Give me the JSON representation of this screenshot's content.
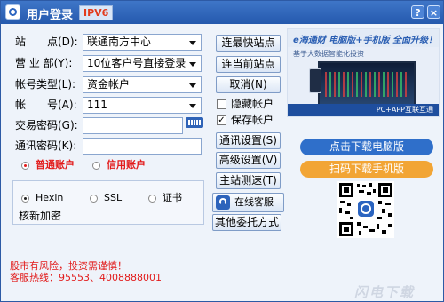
{
  "titlebar": {
    "title": "用户登录",
    "badge": "IPV6",
    "help_label": "?",
    "close_label": "×"
  },
  "form": {
    "labels": {
      "station": "站　　点(D):",
      "department": "营 业 部(Y):",
      "account_type": "帐号类型(L):",
      "account": "帐　　号(A):",
      "trade_password": "交易密码(G):",
      "comm_password": "通讯密码(K):"
    },
    "values": {
      "station": "联通南方中心",
      "department": "10位客户号直接登录",
      "account_type": "资金帐户",
      "account": "111",
      "trade_password": "",
      "comm_password": ""
    },
    "account_kind": {
      "normal": "普通账户",
      "credit": "信用账户",
      "selected": "normal"
    },
    "protocol": {
      "options": [
        "Hexin",
        "SSL",
        "证书"
      ],
      "selected": "Hexin",
      "encrypt_label": "核新加密"
    }
  },
  "buttons": {
    "fastest_station": "连最快站点",
    "current_station": "连当前站点",
    "cancel": "取消(N)",
    "comm_settings": "通讯设置(S)",
    "advanced_settings": "高级设置(V)",
    "station_test": "主站测速(T)",
    "online_service": "在线客服",
    "other_methods": "其他委托方式"
  },
  "checkboxes": {
    "hide_account": {
      "label": "隐藏帐户",
      "checked": false
    },
    "save_account": {
      "label": "保存帐户",
      "checked": true,
      "mark": "✓"
    }
  },
  "ad": {
    "title": "e海通财 电脑版+手机版 全面升级！",
    "subtitle": "基于大数据智能化投资",
    "band": "PC+APP互联互通"
  },
  "download": {
    "pc": "点击下载电脑版",
    "mobile": "扫码下载手机版"
  },
  "footer": {
    "risk": "股市有风险，投资需谨慎！",
    "hotline": "客服热线：95553、4008888001"
  },
  "watermark": "闪电下载",
  "colors": {
    "titlebar": "#2559ad",
    "accent_red": "#e21b1b",
    "download_blue": "#2f6fca",
    "download_orange": "#f2a535"
  }
}
